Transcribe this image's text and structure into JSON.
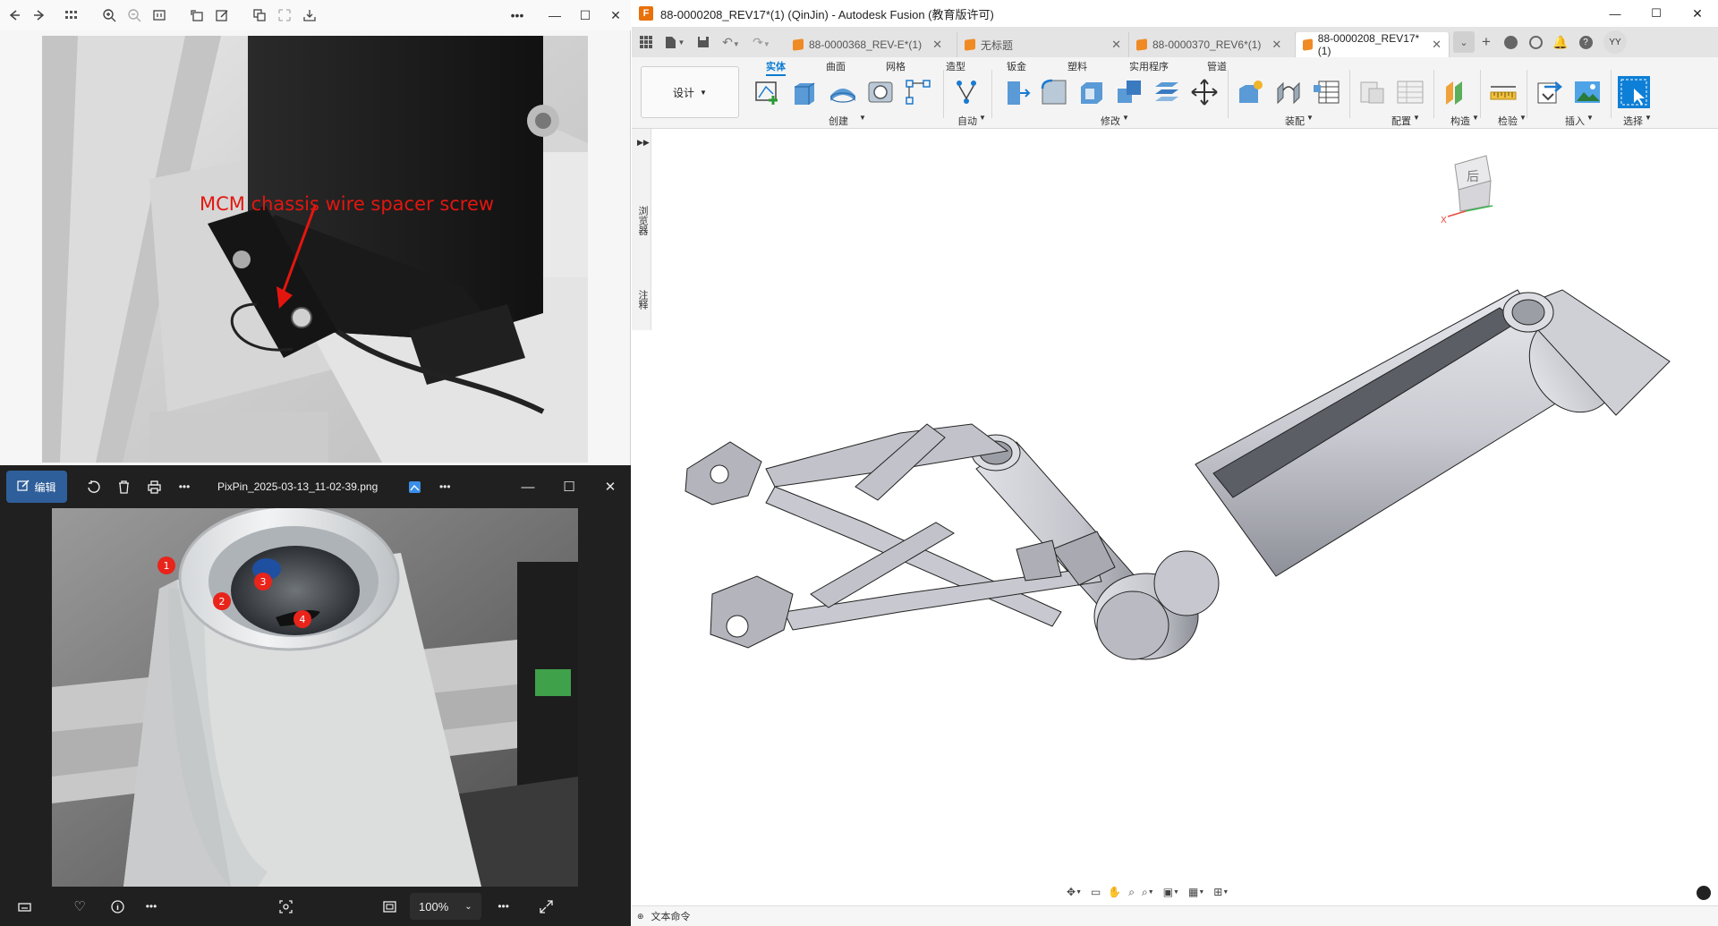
{
  "viewer1": {
    "annotation_text": "MCM chassis wire spacer screw"
  },
  "viewer2": {
    "edit_label": "编辑",
    "filename": "PixPin_2025-03-13_11-02-39.png",
    "zoom": "100%",
    "markers": [
      "1",
      "2",
      "3",
      "4"
    ]
  },
  "fusion": {
    "title": "88-0000208_REV17*(1) (QinJin) - Autodesk Fusion (教育版许可)",
    "tabs": [
      {
        "label": "88-0000368_REV-E*(1)",
        "active": false
      },
      {
        "label": "无标题",
        "active": false
      },
      {
        "label": "88-0000370_REV6*(1)",
        "active": false
      },
      {
        "label": "88-0000208_REV17*(1)",
        "active": true
      }
    ],
    "user_initials": "YY",
    "workspace": "设计",
    "ribbon_tabs": [
      "实体",
      "曲面",
      "网格",
      "造型",
      "钣金",
      "塑料",
      "实用程序",
      "管道"
    ],
    "ribbon_groups": [
      "创建",
      "自动",
      "修改",
      "装配",
      "配置",
      "构造",
      "检验",
      "插入",
      "选择"
    ],
    "side_labels": [
      "浏览器",
      "注释"
    ],
    "viewcube_label": "后",
    "status_text": "文本命令"
  }
}
